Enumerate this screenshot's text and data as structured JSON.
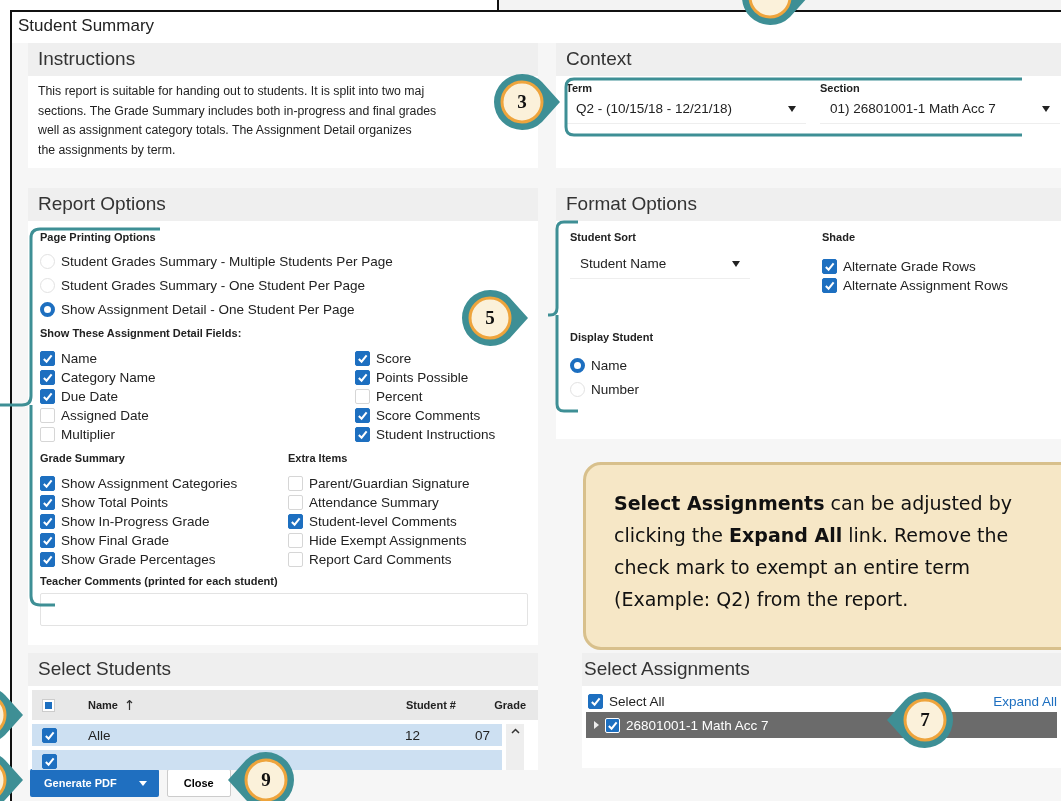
{
  "window": {
    "title": "Student Summary"
  },
  "instructions": {
    "title": "Instructions",
    "lines": [
      "This report is suitable for handing out to students. It is split into two maj",
      "sections. The Grade Summary includes both in-progress and final grades",
      "well as assignment category totals. The Assignment Detail organizes",
      "the assignments by term."
    ]
  },
  "context": {
    "title": "Context",
    "fields": [
      {
        "label": "Term",
        "value": "Q2 - (10/15/18 - 12/21/18)"
      },
      {
        "label": "Section",
        "value": "01) 26801001-1 Math Acc 7"
      }
    ]
  },
  "report_options": {
    "title": "Report Options",
    "page_printing": {
      "label": "Page Printing Options",
      "options": [
        {
          "label": "Student Grades Summary - Multiple Students Per Page",
          "selected": false
        },
        {
          "label": "Student Grades Summary - One Student Per Page",
          "selected": false
        },
        {
          "label": "Show Assignment Detail - One Student Per Page",
          "selected": true
        }
      ]
    },
    "detail_fields": {
      "label": "Show These Assignment Detail Fields:",
      "columns": [
        [
          {
            "label": "Name",
            "checked": true
          },
          {
            "label": "Category Name",
            "checked": true
          },
          {
            "label": "Due Date",
            "checked": true
          },
          {
            "label": "Assigned Date",
            "checked": false
          },
          {
            "label": "Multiplier",
            "checked": false
          }
        ],
        [
          {
            "label": "Score",
            "checked": true
          },
          {
            "label": "Points Possible",
            "checked": true
          },
          {
            "label": "Percent",
            "checked": false
          },
          {
            "label": "Score Comments",
            "checked": true
          },
          {
            "label": "Student Instructions",
            "checked": true
          }
        ]
      ]
    },
    "groups": [
      {
        "label": "Grade Summary",
        "items": [
          {
            "label": "Show Assignment Categories",
            "checked": true
          },
          {
            "label": "Show Total Points",
            "checked": true
          },
          {
            "label": "Show In-Progress Grade",
            "checked": true
          },
          {
            "label": "Show Final Grade",
            "checked": true
          },
          {
            "label": "Show Grade Percentages",
            "checked": true
          }
        ]
      },
      {
        "label": "Extra Items",
        "items": [
          {
            "label": "Parent/Guardian Signature",
            "checked": false
          },
          {
            "label": "Attendance Summary",
            "checked": false
          },
          {
            "label": "Student-level Comments",
            "checked": true
          },
          {
            "label": "Hide Exempt Assignments",
            "checked": false
          },
          {
            "label": "Report Card Comments",
            "checked": false
          }
        ]
      }
    ],
    "teacher_comments": {
      "label": "Teacher Comments (printed for each student)"
    }
  },
  "format_options": {
    "title": "Format Options",
    "student_sort": {
      "label": "Student Sort",
      "value": "Student Name"
    },
    "shade": {
      "label": "Shade",
      "items": [
        {
          "label": "Alternate Grade Rows",
          "checked": true
        },
        {
          "label": "Alternate Assignment Rows",
          "checked": true
        }
      ]
    },
    "display_student": {
      "label": "Display Student",
      "options": [
        {
          "label": "Name",
          "selected": true
        },
        {
          "label": "Number",
          "selected": false
        }
      ]
    }
  },
  "callout": {
    "text": "**Select Assignments** can be adjusted by clicking the **Expand All** link. Remove the check mark to exempt an entire term (Example: Q2) from the report."
  },
  "select_students": {
    "title": "Select Students",
    "header_checkbox": {
      "indeterminate": true
    },
    "columns": [
      "Name",
      "Student #",
      "Grade"
    ],
    "rows": [
      {
        "checked": true,
        "name": "Alle",
        "student_number": "12",
        "grade": "07"
      },
      {
        "checked": true
      }
    ]
  },
  "select_assignments": {
    "title": "Select Assignments",
    "select_all": {
      "label": "Select All",
      "checked": true
    },
    "expand_all": "Expand All",
    "tree": [
      {
        "label": "26801001-1 Math Acc 7",
        "checked": true,
        "expanded": false
      }
    ]
  },
  "buttons": {
    "generate": "Generate PDF",
    "close": "Close"
  },
  "badges": [
    {
      "label": "3"
    },
    {
      "label": "5"
    },
    {
      "label": "7"
    },
    {
      "label": "9"
    }
  ]
}
